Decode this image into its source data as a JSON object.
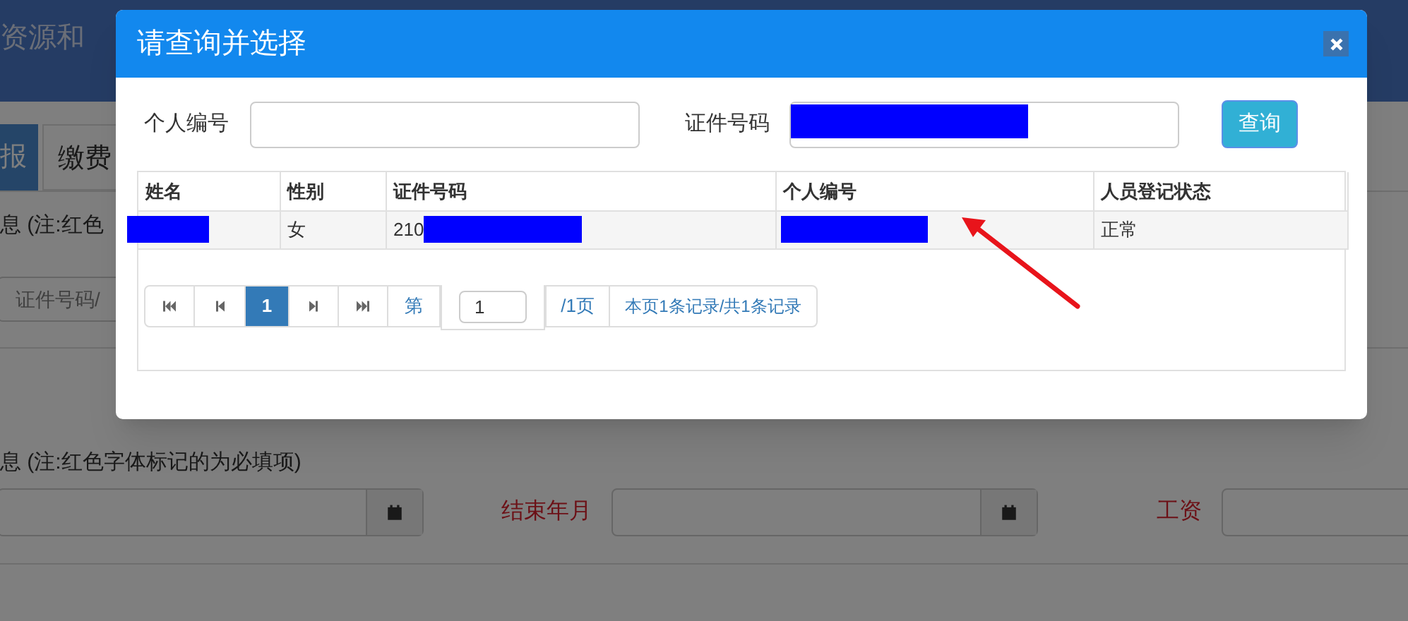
{
  "background_page": {
    "header_title": "资源和",
    "tabs": [
      {
        "label": "报",
        "selected": true
      },
      {
        "label": "缴费",
        "selected": false
      }
    ],
    "section_1": {
      "title": "息 (注:红色",
      "field_placeholder": "证件号码/"
    },
    "section_2": {
      "title": "息 (注:红色字体标记的为必填项)",
      "fields": [
        {
          "kind": "date"
        },
        {
          "kind": "date",
          "label": "结束年月",
          "required": true
        },
        {
          "kind": "text",
          "label": "工资",
          "required": true
        }
      ]
    }
  },
  "modal": {
    "title": "请查询并选择",
    "search": [
      {
        "label": "个人编号",
        "redacted": false
      },
      {
        "label": "证件号码",
        "redacted": true
      }
    ],
    "search_button": "查询",
    "table": {
      "columns": [
        "姓名",
        "性别",
        "证件号码",
        "个人编号",
        "人员登记状态"
      ],
      "rows": [
        {
          "cells": [
            {
              "redacted": true
            },
            {
              "text": "女"
            },
            {
              "text": "210",
              "redacted": true
            },
            {
              "redacted": true
            },
            {
              "text": "正常"
            }
          ]
        }
      ]
    },
    "pagination": {
      "buttons": [
        {
          "kind": "first"
        },
        {
          "kind": "prev"
        },
        {
          "kind": "page",
          "label": "1",
          "selected": true
        },
        {
          "kind": "next"
        },
        {
          "kind": "last"
        }
      ],
      "page_prefix": "第",
      "page_input": "1",
      "page_suffix": "/1页",
      "summary": "本页1条记录/共1条记录"
    }
  }
}
